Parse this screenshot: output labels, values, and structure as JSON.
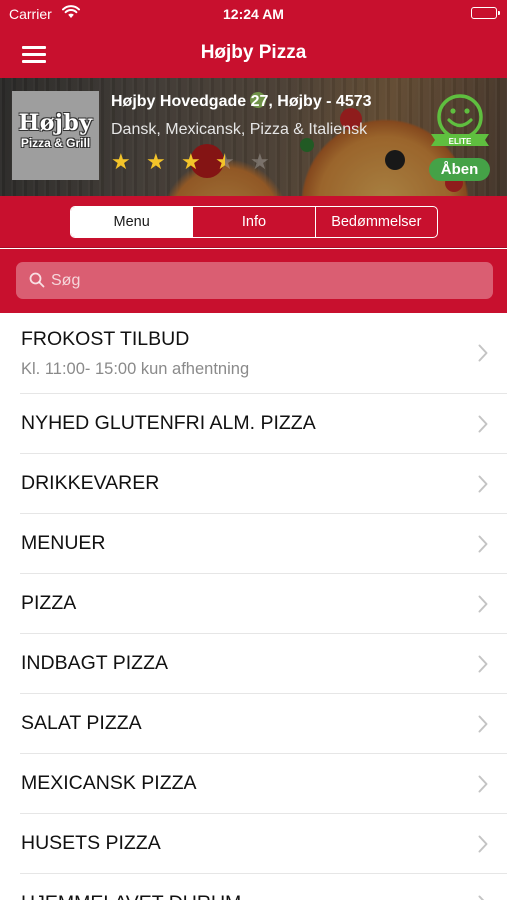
{
  "status_bar": {
    "carrier": "Carrier",
    "time": "12:24 AM"
  },
  "nav": {
    "title": "Højby Pizza"
  },
  "restaurant": {
    "logo_line1": "Højby",
    "logo_line2": "Pizza & Grill",
    "address": "Højby Hovedgade 27, Højby - 4573",
    "cuisine": "Dansk, Mexicansk, Pizza & Italiensk",
    "rating": 3.5,
    "rating_max": 5,
    "badge_text": "ELITE",
    "status": "Åben",
    "status_color": "#45a247"
  },
  "colors": {
    "brand_red": "#c8102e"
  },
  "tabs": [
    {
      "label": "Menu",
      "active": true
    },
    {
      "label": "Info",
      "active": false
    },
    {
      "label": "Bedømmelser",
      "active": false
    }
  ],
  "search": {
    "placeholder": "Søg"
  },
  "categories": [
    {
      "name": "FROKOST TILBUD",
      "subtitle": "Kl. 11:00- 15:00 kun afhentning"
    },
    {
      "name": "NYHED GLUTENFRI ALM. PIZZA"
    },
    {
      "name": "DRIKKEVARER"
    },
    {
      "name": "MENUER"
    },
    {
      "name": "PIZZA"
    },
    {
      "name": "INDBAGT PIZZA"
    },
    {
      "name": "SALAT PIZZA"
    },
    {
      "name": "MEXICANSK PIZZA"
    },
    {
      "name": "HUSETS PIZZA"
    },
    {
      "name": "HJEMMELAVET DURUM"
    }
  ]
}
